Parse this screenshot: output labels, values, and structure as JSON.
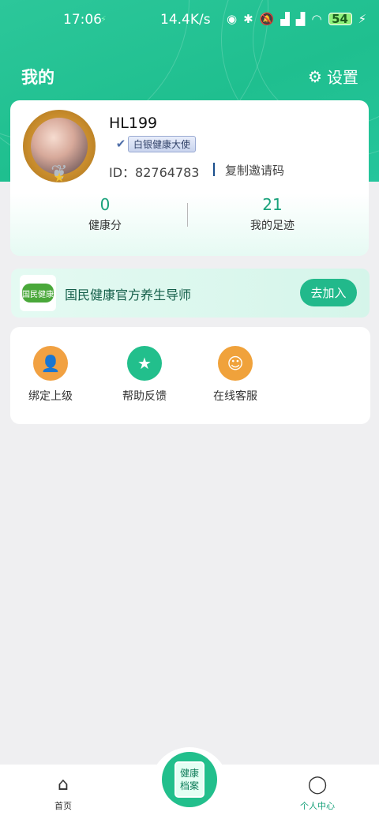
{
  "status_bar": {
    "time": "17:06",
    "network_speed": "14.4K/s",
    "battery": "54"
  },
  "header": {
    "title": "我的",
    "settings_label": "设置"
  },
  "profile": {
    "username": "HL199",
    "badge": "白银健康大使",
    "id_text": "ID：82764783",
    "copy_invite": "复制邀请码",
    "stats": [
      {
        "value": "0",
        "label": "健康分"
      },
      {
        "value": "21",
        "label": "我的足迹"
      }
    ]
  },
  "join_banner": {
    "logo_text": "国民健康",
    "text": "国民健康官方养生导师",
    "button": "去加入"
  },
  "tools": [
    {
      "label": "绑定上级",
      "icon": "user-link-icon",
      "color": "#f1a142"
    },
    {
      "label": "帮助反馈",
      "icon": "bookmark-star-icon",
      "color": "#22bf8c"
    },
    {
      "label": "在线客服",
      "icon": "headset-icon",
      "color": "#f0a23b"
    }
  ],
  "bottom_nav": {
    "home": "首页",
    "center_line1": "健康",
    "center_line2": "档案",
    "profile": "个人中心"
  },
  "colors": {
    "brand": "#22bf8c",
    "accent_orange": "#f1a142"
  }
}
